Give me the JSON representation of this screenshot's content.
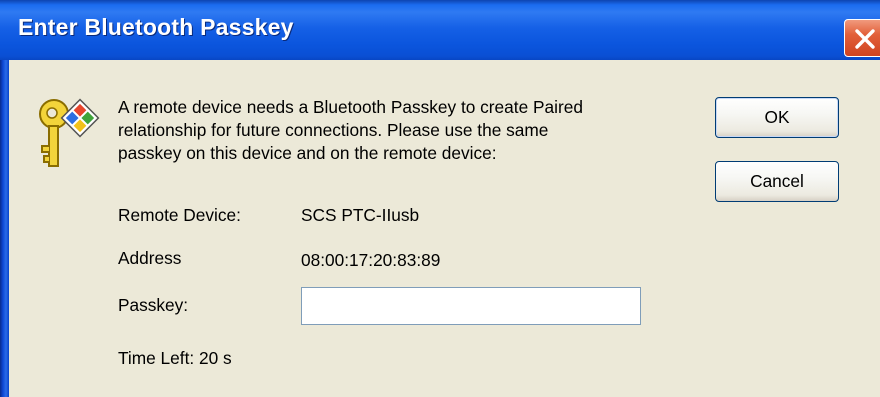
{
  "dialog": {
    "title": "Enter Bluetooth Passkey",
    "message_lines": [
      "A remote device needs a Bluetooth Passkey to create Paired",
      "relationship for future connections. Please use the same",
      "passkey on this device and on the remote device:"
    ],
    "remote_device_label": "Remote Device:",
    "remote_device_value": "SCS PTC-IIusb",
    "address_label": "Address",
    "address_value": "08:00:17:20:83:89",
    "passkey_label": "Passkey:",
    "passkey_value": "",
    "time_left_text": "Time Left: 20 s",
    "ok_label": "OK",
    "cancel_label": "Cancel"
  },
  "icons": {
    "close": "close-icon",
    "key": "key-icon"
  },
  "colors": {
    "titlebar": "#1560e6",
    "dialog_background": "#ece9d8",
    "close_button": "#e2603a",
    "button_border": "#003c74"
  }
}
